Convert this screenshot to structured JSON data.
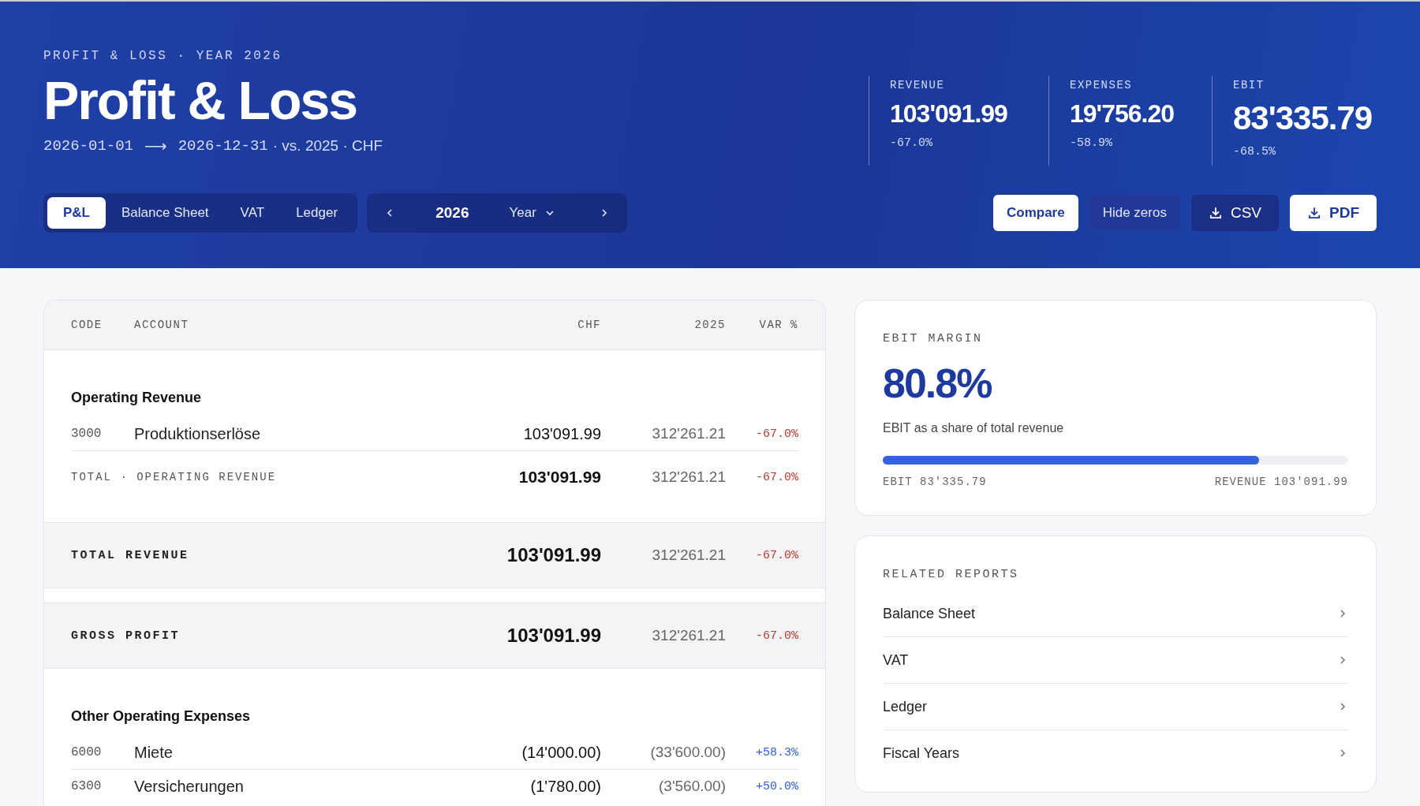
{
  "header": {
    "eyebrow": "PROFIT & LOSS · YEAR 2026",
    "title": "Profit & Loss",
    "period": {
      "start": "2026-01-01",
      "arrow": "⟶",
      "end": "2026-12-31",
      "rest": "· vs. 2025 · CHF"
    },
    "tabs": [
      {
        "label": "P&L",
        "selected": true
      },
      {
        "label": "Balance Sheet",
        "selected": false
      },
      {
        "label": "VAT",
        "selected": false
      },
      {
        "label": "Ledger",
        "selected": false
      }
    ],
    "period_nav": {
      "year": "2026",
      "granularity": "Year"
    },
    "stats": [
      {
        "kind": "standard",
        "label": "REVENUE",
        "value": "103'091.99",
        "change": "-67.0%"
      },
      {
        "kind": "standard",
        "label": "EXPENSES",
        "value": "19'756.20",
        "change": "-58.9%"
      },
      {
        "kind": "headline",
        "label": "EBIT",
        "value": "83'335.79",
        "change": "-68.5%"
      }
    ],
    "buttons": [
      {
        "kind": "primary",
        "label": "Compare"
      },
      {
        "kind": "toggle",
        "label": "Hide zeros"
      },
      {
        "kind": "export",
        "label": "CSV"
      },
      {
        "kind": "export-primary",
        "label": "PDF"
      }
    ]
  },
  "table": {
    "columns": [
      "CODE",
      "ACCOUNT",
      "CHF",
      "2025",
      "VAR %"
    ],
    "rows": [
      {
        "kind": "section",
        "label": "Operating Revenue"
      },
      {
        "kind": "account",
        "code": "3000",
        "account": "Produktionserlöse",
        "chf": "103'091.99",
        "prior": "312'261.21",
        "var": "-67.0%",
        "color": "#c0392b"
      },
      {
        "kind": "subtotal",
        "label": "TOTAL · OPERATING REVENUE",
        "chf": "103'091.99",
        "prior": "312'261.21",
        "var": "-67.0%",
        "color": "#c0392b"
      },
      {
        "kind": "total",
        "label": "TOTAL REVENUE",
        "chf": "103'091.99",
        "prior": "312'261.21",
        "var": "-67.0%",
        "color": "#c0392b"
      },
      {
        "kind": "total",
        "label": "GROSS PROFIT",
        "chf": "103'091.99",
        "prior": "312'261.21",
        "var": "-67.0%",
        "color": "#c0392b"
      },
      {
        "kind": "section",
        "label": "Other Operating Expenses"
      },
      {
        "kind": "account",
        "code": "6000",
        "account": "Miete",
        "chf": "(14'000.00)",
        "prior": "(33'600.00)",
        "var": "+58.3%",
        "color": "#2f5fd6"
      },
      {
        "kind": "account",
        "code": "6300",
        "account": "Versicherungen",
        "chf": "(1'780.00)",
        "prior": "(3'560.00)",
        "var": "+50.0%",
        "color": "#2f5fd6"
      }
    ]
  },
  "margin_card": {
    "title": "EBIT MARGIN",
    "value": "80.8%",
    "caption": "EBIT as a share of total revenue",
    "level": 0.808,
    "left_label": "EBIT 83'335.79",
    "right_label": "REVENUE 103'091.99"
  },
  "related_reports": {
    "title": "RELATED REPORTS",
    "items": [
      "Balance Sheet",
      "VAT",
      "Ledger",
      "Fiscal Years"
    ]
  }
}
